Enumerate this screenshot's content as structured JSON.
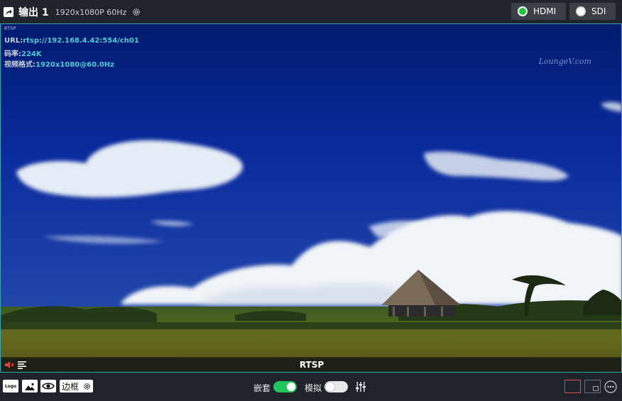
{
  "header": {
    "title": "输出 1",
    "resolution": "1920x1080P 60Hz",
    "icons": {
      "title": "export-icon",
      "settings": "gear-icon"
    },
    "outputs": [
      {
        "label": "HDMI",
        "state": "on",
        "status_color": "#22c43b"
      },
      {
        "label": "SDI",
        "state": "off",
        "status_color": "#ffffff"
      }
    ]
  },
  "preview": {
    "stream_tag": "RTSP",
    "url_label": "URL:",
    "url_value": "rtsp://192.168.4.42:554/ch01",
    "bitrate_label": "码率:",
    "bitrate_value": "224K",
    "format_label": "视频格式:",
    "format_value": "1920x1080@60.0Hz",
    "watermark": "LoungeV.com",
    "source_label": "RTSP",
    "icons": {
      "audio": "mute-icon",
      "menu": "list-icon"
    },
    "border_color": "#3aa6b0"
  },
  "toolbar": {
    "logo_label": "Logo",
    "frame_label": "边框",
    "embed_label": "嵌套",
    "embed_on": true,
    "analog_label": "模拟",
    "analog_on": false,
    "icons": {
      "image": "image-icon",
      "preview": "eye-icon",
      "mixer": "sliders-icon",
      "more": "more-icon",
      "frame_settings": "gear-icon"
    },
    "layouts": [
      "single",
      "pip"
    ],
    "accent_on": "#22c45e",
    "active_layout_color": "#e05050"
  }
}
